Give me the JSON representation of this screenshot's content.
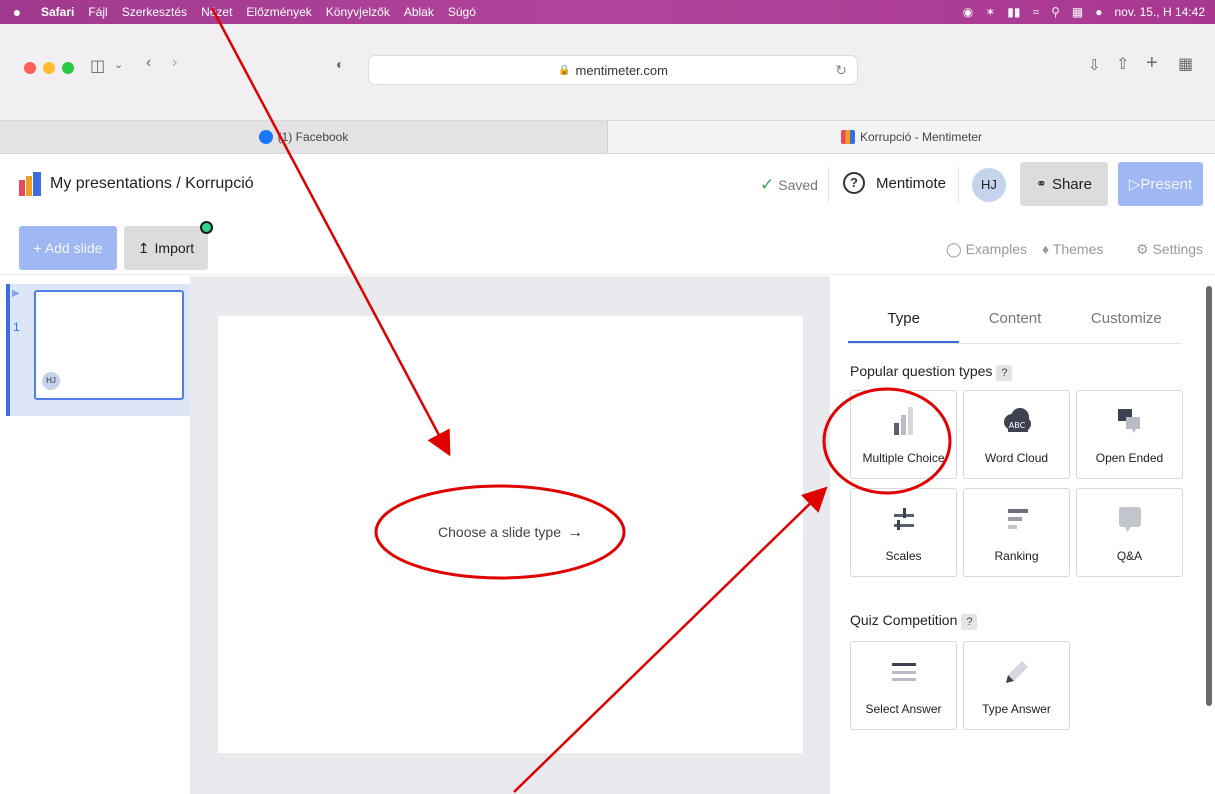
{
  "menubar": {
    "apple": "",
    "app": "Safari",
    "items": [
      "Fájl",
      "Szerkesztés",
      "Nézet",
      "Előzmények",
      "Könyvjelzők",
      "Ablak",
      "Súgó"
    ],
    "clock": "nov. 15., H 14:42"
  },
  "browser": {
    "url": "mentimeter.com",
    "tabs": [
      {
        "label": "(1) Facebook"
      },
      {
        "label": "Korrupció - Mentimeter"
      }
    ]
  },
  "header": {
    "breadcrumb": "My presentations / Korrupció",
    "saved": "Saved",
    "mentimote": "Mentimote",
    "avatar": "HJ",
    "share": "Share",
    "present": "▷Present"
  },
  "toolbar": {
    "add_slide": "+ Add slide",
    "import": "Import",
    "examples": "Examples",
    "themes": "Themes",
    "settings": "Settings"
  },
  "slides": [
    {
      "number": "1",
      "avatar": "HJ"
    }
  ],
  "canvas": {
    "prompt": "Choose a slide type"
  },
  "panel": {
    "tabs": [
      "Type",
      "Content",
      "Customize"
    ],
    "popular_title": "Popular question types",
    "help": "?",
    "popular": [
      {
        "label": "Multiple Choice",
        "icon": "bar-chart-icon"
      },
      {
        "label": "Word Cloud",
        "icon": "word-cloud-icon"
      },
      {
        "label": "Open Ended",
        "icon": "speech-bubbles-icon"
      },
      {
        "label": "Scales",
        "icon": "scales-icon"
      },
      {
        "label": "Ranking",
        "icon": "ranking-icon"
      },
      {
        "label": "Q&A",
        "icon": "qa-bubble-icon"
      }
    ],
    "quiz_title": "Quiz Competition",
    "quiz": [
      {
        "label": "Select Answer",
        "icon": "list-lines-icon"
      },
      {
        "label": "Type Answer",
        "icon": "pencil-icon"
      }
    ]
  },
  "colors": {
    "menubar": "#a8388f",
    "accent_blue": "#3b6fe0",
    "disabled_blue": "#9fb8f4",
    "annotation_red": "#e00000",
    "saved_green": "#3ca35b"
  }
}
